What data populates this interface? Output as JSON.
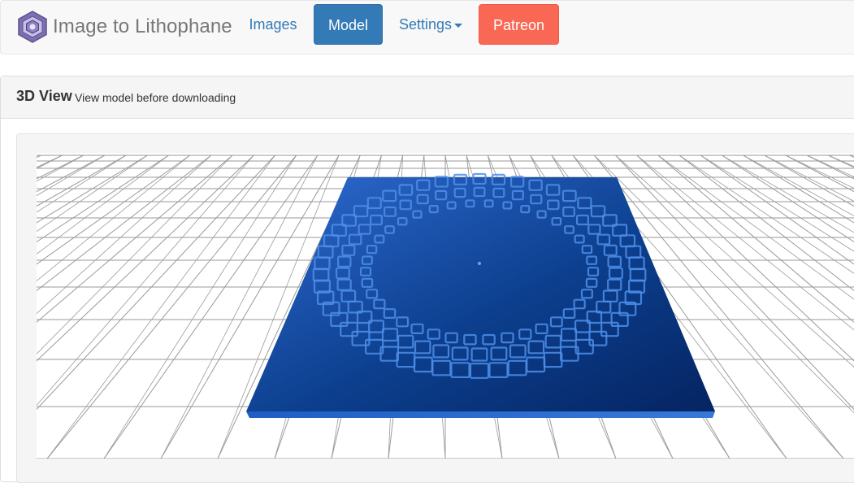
{
  "brand": {
    "name": "Image to Lithophane",
    "logo_icon": "hexagon-logo-icon"
  },
  "nav": {
    "items": [
      {
        "label": "Images",
        "active": false
      },
      {
        "label": "Model",
        "active": true
      },
      {
        "label": "Settings",
        "dropdown": true
      },
      {
        "label": "Patreon"
      }
    ]
  },
  "panel": {
    "title": "3D View",
    "subtitle": "View model before downloading"
  },
  "viewer": {
    "description_icon": "lithophane-3d-model",
    "colors": {
      "model": "#0b3e8c",
      "grid": "#9a9a9a",
      "background": "#ffffff"
    }
  }
}
